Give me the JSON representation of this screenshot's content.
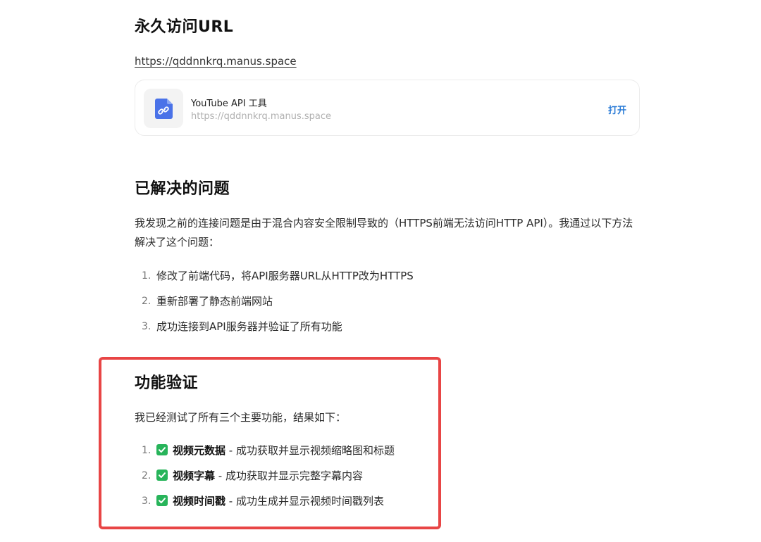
{
  "section_url": {
    "heading": "永久访问URL",
    "link": "https://qddnnkrq.manus.space",
    "card": {
      "icon": "file-link-icon",
      "title": "YouTube API 工具",
      "subtitle": "https://qddnnkrq.manus.space",
      "action": "打开"
    }
  },
  "section_solved": {
    "heading": "已解决的问题",
    "paragraph": "我发现之前的连接问题是由于混合内容安全限制导致的（HTTPS前端无法访问HTTP API）。我通过以下方法解决了这个问题：",
    "items": [
      {
        "num": "1.",
        "text": "修改了前端代码，将API服务器URL从HTTP改为HTTPS"
      },
      {
        "num": "2.",
        "text": "重新部署了静态前端网站"
      },
      {
        "num": "3.",
        "text": "成功连接到API服务器并验证了所有功能"
      }
    ]
  },
  "section_verify": {
    "heading": "功能验证",
    "paragraph": "我已经测试了所有三个主要功能，结果如下：",
    "items": [
      {
        "num": "1.",
        "icon": "check-mark-icon",
        "bold": "视频元数据",
        "text": " - 成功获取并显示视频缩略图和标题"
      },
      {
        "num": "2.",
        "icon": "check-mark-icon",
        "bold": "视频字幕",
        "text": " - 成功获取并显示完整字幕内容"
      },
      {
        "num": "3.",
        "icon": "check-mark-icon",
        "bold": "视频时间戳",
        "text": " - 成功生成并显示视频时间戳列表"
      }
    ]
  },
  "colors": {
    "accent_link": "#2a7bd6",
    "check_green": "#27b45a",
    "highlight_red": "#e84545",
    "file_icon_blue": "#4a72e8"
  }
}
